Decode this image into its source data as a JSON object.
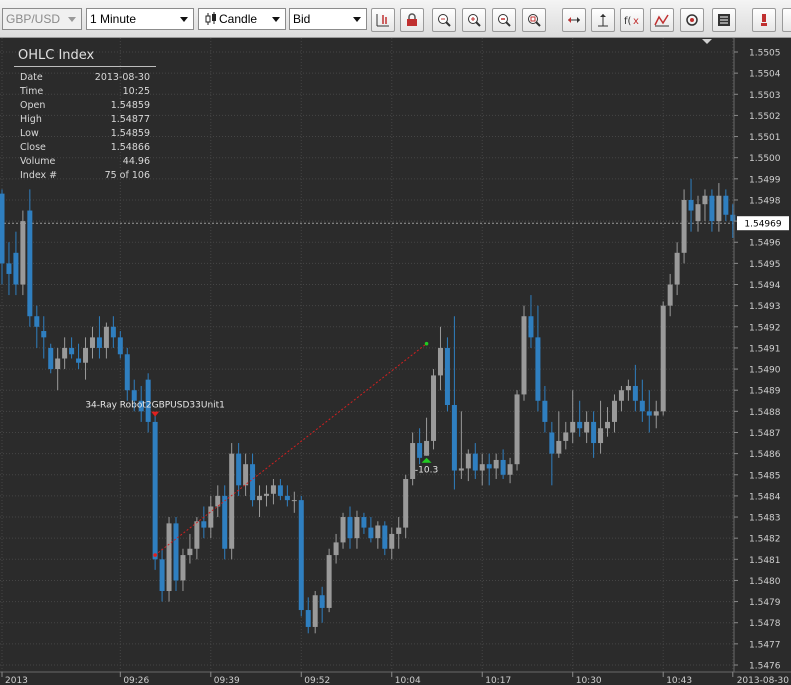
{
  "toolbar": {
    "symbol": "GBP/USD",
    "interval": "1 Minute",
    "chart_style": "Candle",
    "price_side": "Bid",
    "buttons": [
      "crosshair-icon",
      "lock-icon",
      "zoom-fit-icon",
      "zoom-in-icon",
      "zoom-out-icon",
      "zoom-reset-icon",
      "scroll-horizontal-icon",
      "scroll-vertical-icon",
      "function-icon",
      "indicator-icon",
      "settings-icon",
      "legend-icon",
      "alert-icon"
    ]
  },
  "ohlc_panel": {
    "title": "OHLC Index",
    "rows": [
      {
        "label": "Date",
        "value": "2013-08-30"
      },
      {
        "label": "Time",
        "value": "10:25"
      },
      {
        "label": "Open",
        "value": "1.54859"
      },
      {
        "label": "High",
        "value": "1.54877"
      },
      {
        "label": "Low",
        "value": "1.54859"
      },
      {
        "label": "Close",
        "value": "1.54866"
      },
      {
        "label": "Volume",
        "value": "44.96"
      },
      {
        "label": "Index #",
        "value": "75 of 106"
      }
    ]
  },
  "colors": {
    "background": "#2b2b2b",
    "bull": "#9a9a9a",
    "bear": "#2f7fc0",
    "grid": "#454545",
    "trade_line": "#d02020",
    "buy_marker": "#22cc22",
    "sell_marker": "#e02020"
  },
  "chart_data": {
    "type": "candlestick",
    "y_ticks": [
      1.5505,
      1.5504,
      1.5503,
      1.5502,
      1.5501,
      1.55,
      1.5499,
      1.5498,
      1.5497,
      1.5496,
      1.5495,
      1.5494,
      1.5493,
      1.5492,
      1.5491,
      1.549,
      1.5489,
      1.5488,
      1.5487,
      1.5486,
      1.5485,
      1.5484,
      1.5483,
      1.5482,
      1.5481,
      1.548,
      1.5479,
      1.5478,
      1.5477,
      1.5476
    ],
    "y_tick_labels": [
      "1.5505",
      "1.5504",
      "1.5503",
      "1.5502",
      "1.5501",
      "1.5500",
      "1.5499",
      "1.5498",
      "",
      "1.5496",
      "1.5495",
      "1.5494",
      "1.5493",
      "1.5492",
      "1.5491",
      "1.5490",
      "1.5489",
      "1.5488",
      "1.5487",
      "1.5486",
      "1.5485",
      "1.5484",
      "1.5483",
      "1.5482",
      "1.5481",
      "1.5480",
      "1.5479",
      "1.5478",
      "1.5477",
      "1.5476"
    ],
    "x_labels": [
      {
        "index": 0,
        "label": "2013"
      },
      {
        "index": 17,
        "label": "09:26"
      },
      {
        "index": 30,
        "label": "09:39"
      },
      {
        "index": 43,
        "label": "09:52"
      },
      {
        "index": 56,
        "label": "10:04"
      },
      {
        "index": 69,
        "label": "10:17"
      },
      {
        "index": 82,
        "label": "10:30"
      },
      {
        "index": 95,
        "label": "10:43"
      },
      {
        "index": 105,
        "label": "2013-08-30"
      }
    ],
    "last_price": 1.54969,
    "last_price_label": "1.54969",
    "candles": [
      [
        1.54983,
        1.54985,
        1.5494,
        1.5495
      ],
      [
        1.5495,
        1.5496,
        1.54935,
        1.54945
      ],
      [
        1.54955,
        1.54965,
        1.54935,
        1.5494
      ],
      [
        1.5494,
        1.54975,
        1.54935,
        1.5497
      ],
      [
        1.54975,
        1.54985,
        1.5492,
        1.54925
      ],
      [
        1.54925,
        1.5493,
        1.5491,
        1.5492
      ],
      [
        1.54918,
        1.54925,
        1.54905,
        1.54915
      ],
      [
        1.5491,
        1.54912,
        1.54898,
        1.549
      ],
      [
        1.549,
        1.5491,
        1.5489,
        1.54905
      ],
      [
        1.54905,
        1.54915,
        1.549,
        1.5491
      ],
      [
        1.5491,
        1.54915,
        1.54905,
        1.54907
      ],
      [
        1.54905,
        1.54912,
        1.549,
        1.54903
      ],
      [
        1.54903,
        1.54915,
        1.54895,
        1.5491
      ],
      [
        1.5491,
        1.5492,
        1.54905,
        1.54915
      ],
      [
        1.54915,
        1.54925,
        1.54905,
        1.5491
      ],
      [
        1.5491,
        1.54922,
        1.54905,
        1.5492
      ],
      [
        1.5492,
        1.54925,
        1.5491,
        1.54915
      ],
      [
        1.54915,
        1.54918,
        1.54905,
        1.54907
      ],
      [
        1.54907,
        1.5491,
        1.54885,
        1.5489
      ],
      [
        1.5489,
        1.54895,
        1.5488,
        1.54885
      ],
      [
        1.54885,
        1.54892,
        1.54875,
        1.5488
      ],
      [
        1.54895,
        1.54898,
        1.5487,
        1.54875
      ],
      [
        1.54875,
        1.54878,
        1.54805,
        1.5481
      ],
      [
        1.5481,
        1.54815,
        1.5479,
        1.54795
      ],
      [
        1.54795,
        1.5483,
        1.5479,
        1.54827
      ],
      [
        1.54827,
        1.5483,
        1.54795,
        1.548
      ],
      [
        1.548,
        1.54815,
        1.54795,
        1.54812
      ],
      [
        1.54812,
        1.54822,
        1.54808,
        1.54815
      ],
      [
        1.54815,
        1.5483,
        1.5481,
        1.54828
      ],
      [
        1.54828,
        1.54835,
        1.5482,
        1.54825
      ],
      [
        1.54825,
        1.5484,
        1.5482,
        1.54835
      ],
      [
        1.54835,
        1.54845,
        1.5483,
        1.5484
      ],
      [
        1.5484,
        1.54845,
        1.5481,
        1.54815
      ],
      [
        1.54815,
        1.54865,
        1.5481,
        1.5486
      ],
      [
        1.5486,
        1.54865,
        1.5484,
        1.54845
      ],
      [
        1.54845,
        1.5486,
        1.5484,
        1.54855
      ],
      [
        1.54855,
        1.5486,
        1.54835,
        1.54838
      ],
      [
        1.54838,
        1.54845,
        1.5483,
        1.5484
      ],
      [
        1.5484,
        1.54845,
        1.54835,
        1.54841
      ],
      [
        1.54841,
        1.54848,
        1.54836,
        1.54845
      ],
      [
        1.54845,
        1.54848,
        1.54838,
        1.5484
      ],
      [
        1.5484,
        1.54845,
        1.54835,
        1.54838
      ],
      [
        1.54838,
        1.54842,
        1.54832,
        1.54838
      ],
      [
        1.54838,
        1.5484,
        1.54783,
        1.54786
      ],
      [
        1.54786,
        1.54792,
        1.54775,
        1.54778
      ],
      [
        1.54778,
        1.54795,
        1.54775,
        1.54793
      ],
      [
        1.54793,
        1.54797,
        1.5478,
        1.54787
      ],
      [
        1.54787,
        1.54815,
        1.54785,
        1.54812
      ],
      [
        1.54812,
        1.54822,
        1.54808,
        1.54818
      ],
      [
        1.54818,
        1.54832,
        1.54815,
        1.5483
      ],
      [
        1.5483,
        1.54835,
        1.54815,
        1.5482
      ],
      [
        1.5482,
        1.54833,
        1.54815,
        1.5483
      ],
      [
        1.5483,
        1.54832,
        1.54822,
        1.54825
      ],
      [
        1.54825,
        1.5483,
        1.54818,
        1.5482
      ],
      [
        1.5482,
        1.54828,
        1.54815,
        1.54826
      ],
      [
        1.54826,
        1.54828,
        1.54812,
        1.54815
      ],
      [
        1.54815,
        1.54825,
        1.5481,
        1.54822
      ],
      [
        1.54822,
        1.5483,
        1.54815,
        1.54825
      ],
      [
        1.54825,
        1.5485,
        1.5482,
        1.54848
      ],
      [
        1.54848,
        1.5487,
        1.54845,
        1.54865
      ],
      [
        1.54865,
        1.54872,
        1.54855,
        1.54858
      ],
      [
        1.54859,
        1.54877,
        1.54859,
        1.54866
      ],
      [
        1.54866,
        1.549,
        1.54862,
        1.54897
      ],
      [
        1.54897,
        1.5492,
        1.5489,
        1.5491
      ],
      [
        1.5491,
        1.54915,
        1.5488,
        1.54883
      ],
      [
        1.54883,
        1.54925,
        1.54843,
        1.54852
      ],
      [
        1.54852,
        1.5488,
        1.54848,
        1.54853
      ],
      [
        1.54853,
        1.54862,
        1.54847,
        1.5486
      ],
      [
        1.5486,
        1.54865,
        1.54848,
        1.54852
      ],
      [
        1.54852,
        1.5486,
        1.54845,
        1.54855
      ],
      [
        1.54855,
        1.5486,
        1.54845,
        1.54853
      ],
      [
        1.54853,
        1.5486,
        1.54848,
        1.54857
      ],
      [
        1.54857,
        1.54862,
        1.54848,
        1.5485
      ],
      [
        1.5485,
        1.54858,
        1.54846,
        1.54855
      ],
      [
        1.54855,
        1.5489,
        1.54852,
        1.54888
      ],
      [
        1.54888,
        1.5493,
        1.54885,
        1.54925
      ],
      [
        1.54925,
        1.54935,
        1.5491,
        1.54915
      ],
      [
        1.54915,
        1.5493,
        1.5488,
        1.54885
      ],
      [
        1.54885,
        1.54892,
        1.5487,
        1.54875
      ],
      [
        1.5487,
        1.54875,
        1.54845,
        1.5486
      ],
      [
        1.5486,
        1.5488,
        1.54858,
        1.54866
      ],
      [
        1.54866,
        1.54875,
        1.54862,
        1.5487
      ],
      [
        1.5487,
        1.5489,
        1.54865,
        1.54875
      ],
      [
        1.54875,
        1.54885,
        1.54868,
        1.54872
      ],
      [
        1.5487,
        1.5488,
        1.54865,
        1.54875
      ],
      [
        1.54875,
        1.5488,
        1.54858,
        1.54865
      ],
      [
        1.54865,
        1.54885,
        1.5486,
        1.54872
      ],
      [
        1.54872,
        1.54882,
        1.54868,
        1.54875
      ],
      [
        1.54875,
        1.54888,
        1.5487,
        1.54885
      ],
      [
        1.54885,
        1.54892,
        1.5488,
        1.5489
      ],
      [
        1.5489,
        1.54895,
        1.54885,
        1.54892
      ],
      [
        1.54892,
        1.54902,
        1.5488,
        1.54885
      ],
      [
        1.54885,
        1.54895,
        1.54875,
        1.5488
      ],
      [
        1.5488,
        1.5489,
        1.5487,
        1.54878
      ],
      [
        1.54878,
        1.54885,
        1.54872,
        1.5488
      ],
      [
        1.5488,
        1.54932,
        1.54878,
        1.5493
      ],
      [
        1.5493,
        1.54945,
        1.54925,
        1.5494
      ],
      [
        1.5494,
        1.5496,
        1.54935,
        1.54955
      ],
      [
        1.54955,
        1.54985,
        1.5495,
        1.5498
      ],
      [
        1.5498,
        1.5499,
        1.54965,
        1.54975
      ],
      [
        1.5497,
        1.54982,
        1.54965,
        1.54978
      ],
      [
        1.54978,
        1.54985,
        1.5497,
        1.54982
      ],
      [
        1.54982,
        1.54985,
        1.54965,
        1.5497
      ],
      [
        1.5497,
        1.54988,
        1.54965,
        1.54982
      ],
      [
        1.54982,
        1.54985,
        1.5497,
        1.54973
      ],
      [
        1.54973,
        1.54978,
        1.54962,
        1.5497
      ]
    ],
    "trade": {
      "label": "34-Ray Robot2GBPUSD33Unit1",
      "entry_index": 22,
      "entry_price": 1.54812,
      "exit_index": 61,
      "exit_price": 1.54912,
      "result_label": "-10.3"
    }
  }
}
